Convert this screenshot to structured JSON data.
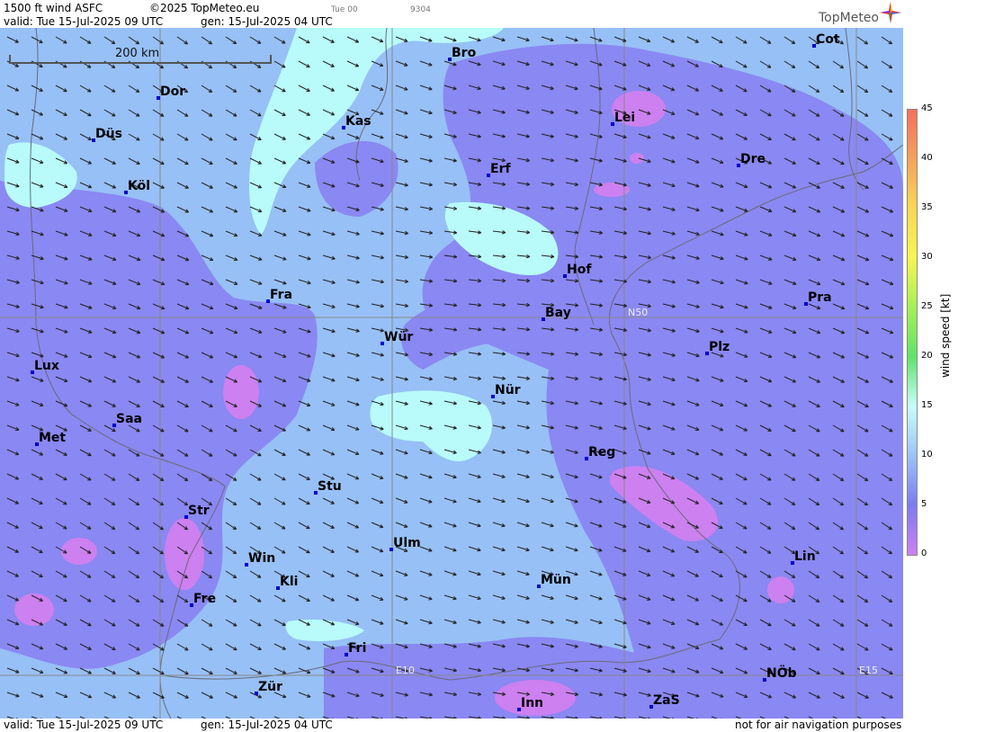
{
  "header": {
    "product": "1500 ft wind ASFC",
    "copyright": "©2025 TopMeteo.eu",
    "run_small": "Tue 00",
    "code_small": "9304",
    "valid": "valid:  Tue  15-Jul-2025  09 UTC",
    "gen": "gen: 15-Jul-2025 04 UTC"
  },
  "logo": {
    "text": "TopMeteo",
    "icon": "compass-star-icon"
  },
  "scale": {
    "label": "200 km"
  },
  "grid_labels": {
    "n50": "N50",
    "e10": "E10",
    "e15": "E15"
  },
  "cities": [
    {
      "name": "Mün",
      "key": "munster"
    },
    {
      "name": "Bro",
      "key": "brocken"
    },
    {
      "name": "Cot",
      "key": "cottbus"
    },
    {
      "name": "Dor",
      "key": "dortmund"
    },
    {
      "name": "Kas",
      "key": "kassel"
    },
    {
      "name": "Lei",
      "key": "leipzig"
    },
    {
      "name": "Düs",
      "key": "dusseldorf"
    },
    {
      "name": "Erf",
      "key": "erfurt"
    },
    {
      "name": "Dre",
      "key": "dresden"
    },
    {
      "name": "Köl",
      "key": "koln"
    },
    {
      "name": "Hof",
      "key": "hof"
    },
    {
      "name": "Fra",
      "key": "frankfurt"
    },
    {
      "name": "Pra",
      "key": "praha"
    },
    {
      "name": "Bay",
      "key": "bayreuth"
    },
    {
      "name": "Wür",
      "key": "wurzburg"
    },
    {
      "name": "Plz",
      "key": "plzen"
    },
    {
      "name": "Lux",
      "key": "luxembourg"
    },
    {
      "name": "Nür",
      "key": "nurnberg"
    },
    {
      "name": "Saa",
      "key": "saarbrucken"
    },
    {
      "name": "Met",
      "key": "metz"
    },
    {
      "name": "Reg",
      "key": "regensburg"
    },
    {
      "name": "Stu",
      "key": "stuttgart"
    },
    {
      "name": "Str",
      "key": "strasbourg"
    },
    {
      "name": "Ulm",
      "key": "ulm"
    },
    {
      "name": "Win",
      "key": "winterthur"
    },
    {
      "name": "Lin",
      "key": "linz"
    },
    {
      "name": "Kli",
      "key": "klippeneck"
    },
    {
      "name": "Mün",
      "key": "munchen"
    },
    {
      "name": "Fre",
      "key": "freiburg"
    },
    {
      "name": "Fri",
      "key": "friedrichshafen"
    },
    {
      "name": "NÖb",
      "key": "niederoesterreich"
    },
    {
      "name": "Zür",
      "key": "zurich"
    },
    {
      "name": "Inn",
      "key": "innsbruck"
    },
    {
      "name": "ZaS",
      "key": "zellamsee"
    }
  ],
  "legend": {
    "title": "wind speed [kt]",
    "ticks": [
      "45",
      "40",
      "35",
      "30",
      "25",
      "20",
      "15",
      "10",
      "5",
      "0"
    ],
    "colors": [
      "#f3705f",
      "#f6a25a",
      "#fbd855",
      "#f6f64f",
      "#a6ef56",
      "#5fe36a",
      "#c8fdfb",
      "#9cc3f7",
      "#7c7bef",
      "#cd80f0"
    ]
  },
  "footer": {
    "valid": "valid:  Tue  15-Jul-2025  09 UTC",
    "gen": "gen: 15-Jul-2025 04 UTC",
    "disclaimer": "not for air navigation purposes"
  },
  "colors": {
    "calm": "#cd80f0",
    "light": "#8a88f2",
    "moderate": "#97c0f6",
    "fresh": "#b8fbfa"
  }
}
